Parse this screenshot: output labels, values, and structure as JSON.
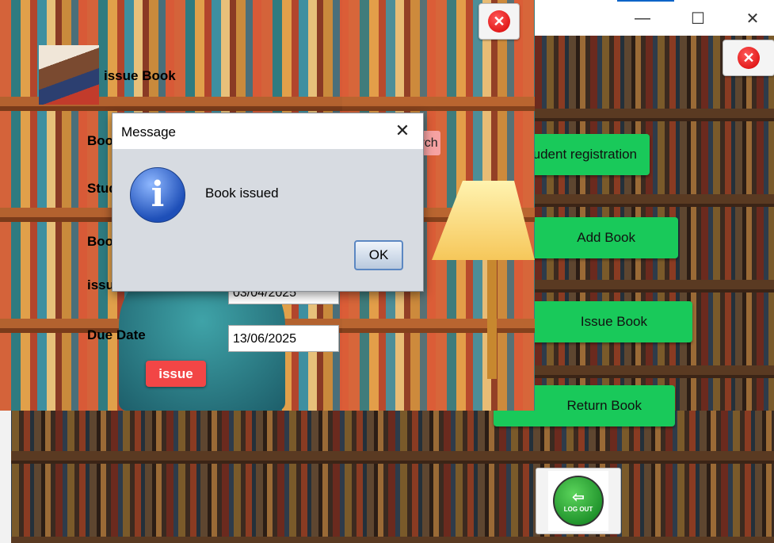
{
  "main_window": {
    "menu_buttons": [
      {
        "id": "student-registration",
        "label": "Student registration"
      },
      {
        "id": "add-book",
        "label": "Add Book"
      },
      {
        "id": "issue-book",
        "label": "Issue Book"
      },
      {
        "id": "return-book",
        "label": "Return Book"
      }
    ],
    "logout": {
      "icon_text": "LOG OUT"
    },
    "controls": {
      "minimize": "—",
      "maximize": "☐",
      "close": "✕"
    }
  },
  "issue_window": {
    "title": "issue Book",
    "labels": {
      "book_id": "Book ID",
      "student_id": "Student ID",
      "book_name": "Book Name",
      "issue_date": "issue Date",
      "due_date": "Due Date"
    },
    "issue_date_value": "03/04/2025",
    "due_date_value": "13/06/2025",
    "search_button_label": "Search",
    "issue_button_label": "issue"
  },
  "dialog": {
    "title": "Message",
    "message": "Book issued",
    "ok_label": "OK",
    "close_glyph": "✕",
    "info_glyph": "i"
  },
  "close_icon_glyph": "✕"
}
